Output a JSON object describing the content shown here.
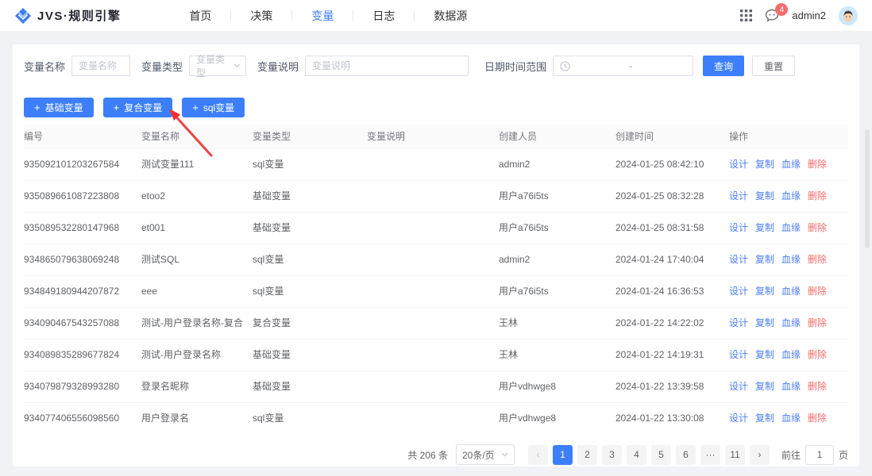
{
  "header": {
    "logo_text": "JVS·规则引擎",
    "nav": [
      {
        "label": "首页"
      },
      {
        "label": "决策"
      },
      {
        "label": "变量"
      },
      {
        "label": "日志"
      },
      {
        "label": "数据源"
      }
    ],
    "notification_count": "4",
    "username": "admin2"
  },
  "filters": {
    "name": {
      "label": "变量名称",
      "placeholder": "变量名称"
    },
    "type": {
      "label": "变量类型",
      "placeholder": "变量类型"
    },
    "desc": {
      "label": "变量说明",
      "placeholder": "变量说明"
    },
    "date": {
      "label": "日期时间范围",
      "separator": "-"
    },
    "search_button": "查询",
    "reset_button": "重置"
  },
  "toolbar": {
    "plus": "+",
    "buttons": [
      "基础变量",
      "复合变量",
      "sql变量"
    ]
  },
  "table": {
    "columns": [
      "编号",
      "变量名称",
      "变量类型",
      "变量说明",
      "创建人员",
      "创建时间",
      "操作"
    ],
    "actions": [
      "设计",
      "复制",
      "血缘",
      "删除"
    ],
    "rows": [
      {
        "id": "935092101203267584",
        "name": "测试变量111",
        "type": "sql变量",
        "desc": "",
        "creator": "admin2",
        "time": "2024-01-25 08:42:10"
      },
      {
        "id": "935089661087223808",
        "name": "etoo2",
        "type": "基础变量",
        "desc": "",
        "creator": "用户a76i5ts",
        "time": "2024-01-25 08:32:28"
      },
      {
        "id": "935089532280147968",
        "name": "et001",
        "type": "基础变量",
        "desc": "",
        "creator": "用户a76i5ts",
        "time": "2024-01-25 08:31:58"
      },
      {
        "id": "934865079638069248",
        "name": "测试SQL",
        "type": "sql变量",
        "desc": "",
        "creator": "admin2",
        "time": "2024-01-24 17:40:04"
      },
      {
        "id": "934849180944207872",
        "name": "eee",
        "type": "sql变量",
        "desc": "",
        "creator": "用户a76i5ts",
        "time": "2024-01-24 16:36:53"
      },
      {
        "id": "934090467543257088",
        "name": "测试-用户登录名称-复合",
        "type": "复合变量",
        "desc": "",
        "creator": "王林",
        "time": "2024-01-22 14:22:02"
      },
      {
        "id": "934089835289677824",
        "name": "测试-用户登录名称",
        "type": "基础变量",
        "desc": "",
        "creator": "王林",
        "time": "2024-01-22 14:19:31"
      },
      {
        "id": "934079879328993280",
        "name": "登录名昵称",
        "type": "基础变量",
        "desc": "",
        "creator": "用户vdhwge8",
        "time": "2024-01-22 13:39:58"
      },
      {
        "id": "934077406556098560",
        "name": "用户登录名",
        "type": "sql变量",
        "desc": "",
        "creator": "用户vdhwge8",
        "time": "2024-01-22 13:30:08"
      }
    ]
  },
  "pagination": {
    "total": "共 206 条",
    "page_size": "20条/页",
    "prev": "‹",
    "next": "›",
    "pages": [
      "1",
      "2",
      "3",
      "4",
      "5",
      "6",
      "···",
      "11"
    ],
    "goto_label": "前往",
    "goto_value": "1",
    "goto_unit": "页"
  },
  "colors": {
    "primary": "#3d7ffb",
    "danger": "#f56c6c",
    "arrow_red": "#ee2f2f"
  }
}
